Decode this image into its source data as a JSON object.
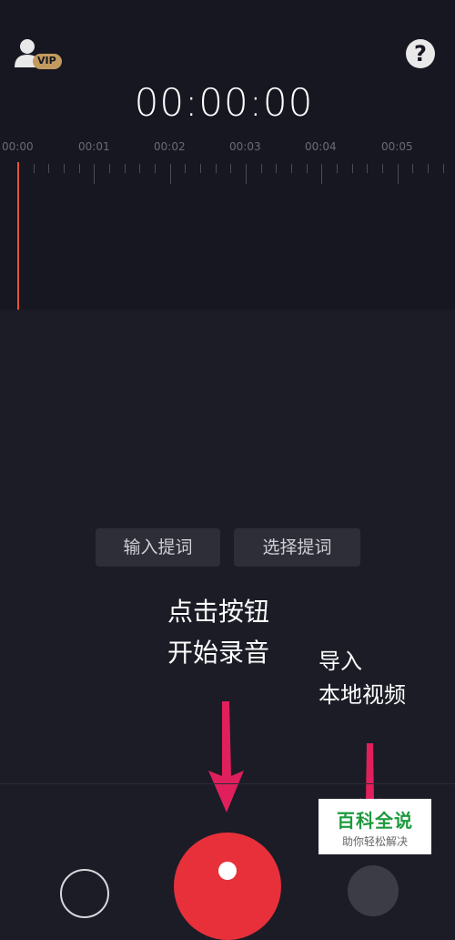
{
  "header": {
    "vip_badge": "VIP",
    "help_label": "?"
  },
  "timer": "00:00:00",
  "ruler": {
    "labels": [
      "00:00",
      "00:01",
      "00:02",
      "00:03",
      "00:04",
      "00:05"
    ]
  },
  "prompt_buttons": {
    "input_prompt": "输入提词",
    "select_prompt": "选择提词"
  },
  "annotations": {
    "record_hint_line1": "点击按钮",
    "record_hint_line2": "开始录音",
    "import_hint_line1": "导入",
    "import_hint_line2": "本地视频"
  },
  "watermark": {
    "title": "百科全说",
    "subtitle": "助你轻松解决"
  },
  "colors": {
    "accent_red": "#e8303b",
    "arrow": "#e0205c",
    "playhead": "#e6553a",
    "watermark_green": "#1d9a3e"
  }
}
